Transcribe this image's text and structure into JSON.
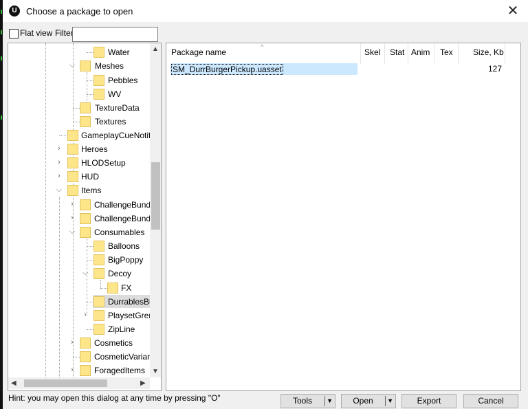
{
  "window": {
    "title": "Choose a package to open",
    "logo_letter": "U",
    "close_glyph": "✕"
  },
  "options": {
    "flat_view_label": "Flat view",
    "filter_label": "Filter:",
    "filter_value": ""
  },
  "tree": {
    "items": [
      {
        "label": "Water"
      },
      {
        "label": "Meshes"
      },
      {
        "label": "Pebbles"
      },
      {
        "label": "WV"
      },
      {
        "label": "TextureData"
      },
      {
        "label": "Textures"
      },
      {
        "label": "GameplayCueNotifies"
      },
      {
        "label": "Heroes"
      },
      {
        "label": "HLODSetup"
      },
      {
        "label": "HUD"
      },
      {
        "label": "Items"
      },
      {
        "label": "ChallengeBundles"
      },
      {
        "label": "ChallengeBundleSchedules"
      },
      {
        "label": "Consumables"
      },
      {
        "label": "Balloons"
      },
      {
        "label": "BigPoppy"
      },
      {
        "label": "Decoy"
      },
      {
        "label": "FX"
      },
      {
        "label": "DurrablesBurger"
      },
      {
        "label": "PlaysetGrenade"
      },
      {
        "label": "ZipLine"
      },
      {
        "label": "Cosmetics"
      },
      {
        "label": "CosmeticVariantTokens"
      },
      {
        "label": "ForagedItems"
      }
    ],
    "expander_expanded": "⌵",
    "expander_collapsed": "›",
    "scroll_up": "▲",
    "scroll_down": "▼",
    "scroll_left": "◀",
    "scroll_right": "▶"
  },
  "list": {
    "sort_indicator": "^",
    "columns": [
      "Package name",
      "Skel",
      "Stat",
      "Anim",
      "Tex",
      "Size, Kb"
    ],
    "rows": [
      {
        "name": "SM_DurrBurgerPickup.uasset",
        "size": "127"
      }
    ]
  },
  "footer": {
    "hint": "Hint: you may open this dialog at any time by pressing \"O\"",
    "tools_label": "Tools",
    "open_label": "Open",
    "export_label": "Export",
    "cancel_label": "Cancel",
    "dropdown_glyph": "▼"
  },
  "colors": {
    "selection": "#cce8ff",
    "folder": "#fde68a"
  }
}
